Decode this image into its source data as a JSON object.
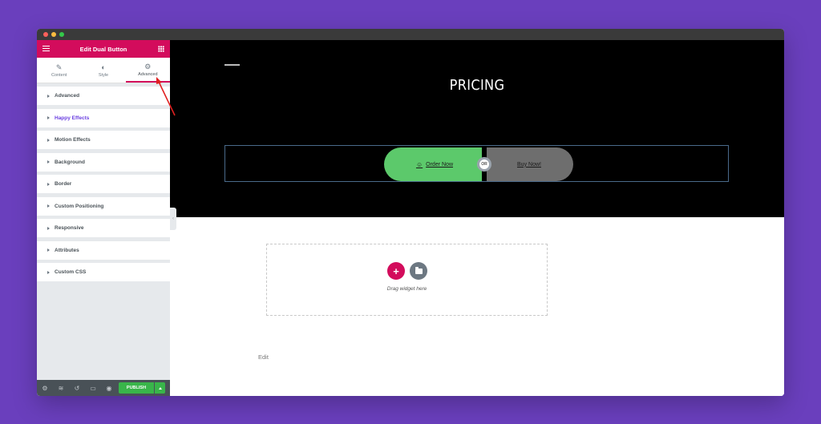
{
  "window": {
    "traffic_lights": [
      "close",
      "minimize",
      "zoom"
    ]
  },
  "panel": {
    "title": "Edit Dual Button",
    "tabs": [
      {
        "label": "Content",
        "icon": "pencil-icon"
      },
      {
        "label": "Style",
        "icon": "contrast-icon"
      },
      {
        "label": "Advanced",
        "icon": "gear-icon",
        "active": true
      }
    ],
    "sections": [
      {
        "label": "Advanced"
      },
      {
        "label": "Happy Effects",
        "highlight": true
      },
      {
        "label": "Motion Effects"
      },
      {
        "label": "Background"
      },
      {
        "label": "Border"
      },
      {
        "label": "Custom Positioning"
      },
      {
        "label": "Responsive"
      },
      {
        "label": "Attributes"
      },
      {
        "label": "Custom CSS"
      }
    ],
    "footer": {
      "icons": [
        "settings-icon",
        "layers-icon",
        "history-icon",
        "responsive-icon",
        "preview-icon"
      ],
      "publish_label": "PUBLISH"
    }
  },
  "canvas": {
    "hero_title": "PRICING",
    "primary_button": "Order Now",
    "connector": "OR",
    "secondary_button": "Buy Now!",
    "dropzone_text": "Drag widget here",
    "edit_label": "Edit"
  },
  "colors": {
    "brand": "#d30c5c",
    "primary_button": "#5cc96b",
    "secondary_button": "#6e6e6e",
    "publish": "#39b54a",
    "background": "#6a3fbd",
    "highlight_text": "#6a3fe0"
  }
}
